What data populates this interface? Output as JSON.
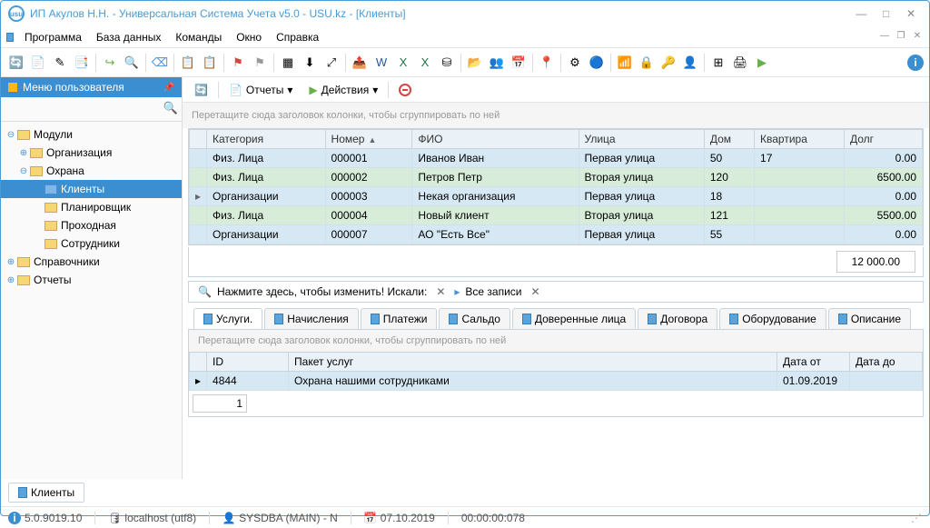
{
  "title": "ИП Акулов Н.Н. - Универсальная Система Учета v5.0 - USU.kz - [Клиенты]",
  "menu": {
    "program": "Программа",
    "database": "База данных",
    "commands": "Команды",
    "window": "Окно",
    "help": "Справка"
  },
  "sidebar": {
    "title": "Меню пользователя",
    "items": {
      "modules": "Модули",
      "org": "Организация",
      "security": "Охрана",
      "clients": "Клиенты",
      "planner": "Планировщик",
      "passage": "Проходная",
      "staff": "Сотрудники",
      "refs": "Справочники",
      "reports": "Отчеты"
    }
  },
  "contentbar": {
    "reports": "Отчеты",
    "actions": "Действия"
  },
  "group_hint": "Перетащите сюда заголовок колонки, чтобы сгруппировать по ней",
  "grid": {
    "cols": {
      "category": "Категория",
      "number": "Номер",
      "fio": "ФИО",
      "street": "Улица",
      "house": "Дом",
      "flat": "Квартира",
      "debt": "Долг"
    },
    "rows": [
      {
        "category": "Физ. Лица",
        "number": "000001",
        "fio": "Иванов Иван",
        "street": "Первая улица",
        "house": "50",
        "flat": "17",
        "debt": "0.00"
      },
      {
        "category": "Физ. Лица",
        "number": "000002",
        "fio": "Петров Петр",
        "street": "Вторая улица",
        "house": "120",
        "flat": "",
        "debt": "6500.00"
      },
      {
        "category": "Организации",
        "number": "000003",
        "fio": "Некая организация",
        "street": "Первая улица",
        "house": "18",
        "flat": "",
        "debt": "0.00"
      },
      {
        "category": "Физ. Лица",
        "number": "000004",
        "fio": "Новый клиент",
        "street": "Вторая улица",
        "house": "121",
        "flat": "",
        "debt": "5500.00"
      },
      {
        "category": "Организации",
        "number": "000007",
        "fio": "АО \"Есть Все\"",
        "street": "Первая улица",
        "house": "55",
        "flat": "",
        "debt": "0.00"
      }
    ],
    "total_debt": "12 000.00"
  },
  "searchline": {
    "prompt": "Нажмите здесь, чтобы изменить! Искали:",
    "all": "Все записи"
  },
  "tabs": {
    "services": "Услуги.",
    "charges": "Начисления",
    "payments": "Платежи",
    "balance": "Сальдо",
    "trusted": "Доверенные лица",
    "contracts": "Договора",
    "equipment": "Оборудование",
    "desc": "Описание"
  },
  "subgrid": {
    "cols": {
      "id": "ID",
      "package": "Пакет услуг",
      "date_from": "Дата от",
      "date_to": "Дата до"
    },
    "row": {
      "id": "4844",
      "package": "Охрана нашими сотрудниками",
      "date_from": "01.09.2019",
      "date_to": ""
    }
  },
  "page": "1",
  "bottom_tab": "Клиенты",
  "status": {
    "version": "5.0.9019.10",
    "host": "localhost (utf8)",
    "user": "SYSDBA (MAIN) - N",
    "date": "07.10.2019",
    "time": "00:00:00:078"
  }
}
